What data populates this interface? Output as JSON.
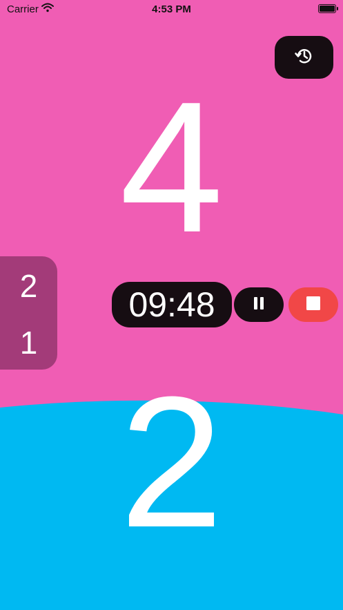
{
  "status_bar": {
    "carrier": "Carrier",
    "time": "4:53 PM"
  },
  "scores": {
    "top": "4",
    "bottom": "2"
  },
  "side_panel": {
    "top": "2",
    "bottom": "1"
  },
  "timer": {
    "value": "09:48"
  },
  "icons": {
    "history": "history-icon",
    "pause": "pause-icon",
    "stop": "stop-icon"
  },
  "colors": {
    "top_team": "#f05db4",
    "bottom_team": "#00b9f2",
    "side_panel": "#a33b79",
    "button_dark": "#160d12",
    "stop_button": "#f14747"
  }
}
